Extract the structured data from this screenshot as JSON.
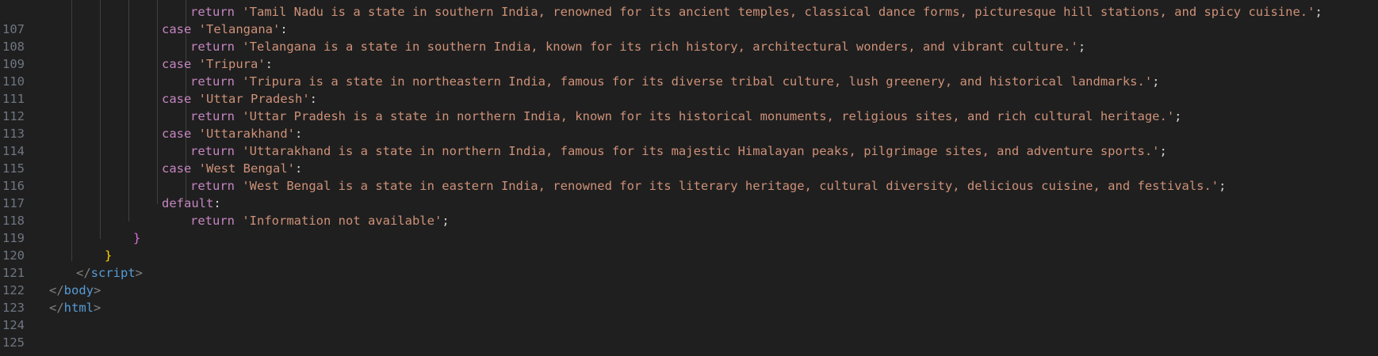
{
  "editor": {
    "theme_colors": {
      "background": "#1f1f1f",
      "line_number": "#6e7681",
      "keyword": "#c586c0",
      "string": "#ce9178",
      "punctuation": "#d4d4d4",
      "brace_level_2": "#da70d6",
      "brace_level_1": "#ffd700",
      "tag_bracket": "#808080",
      "tag_name": "#569cd6"
    },
    "lines": [
      {
        "num": "107",
        "kw": "return",
        "str": "'Tamil Nadu is a state in southern India, renowned for its ancient temples, classical dance forms, picturesque hill stations, and spicy cuisine.'",
        "end": ";"
      },
      {
        "num": "108",
        "kw": "case",
        "str": "'Telangana'",
        "end": ":"
      },
      {
        "num": "109",
        "kw": "return",
        "str": "'Telangana is a state in southern India, known for its rich history, architectural wonders, and vibrant culture.'",
        "end": ";"
      },
      {
        "num": "110",
        "kw": "case",
        "str": "'Tripura'",
        "end": ":"
      },
      {
        "num": "111",
        "kw": "return",
        "str": "'Tripura is a state in northeastern India, famous for its diverse tribal culture, lush greenery, and historical landmarks.'",
        "end": ";"
      },
      {
        "num": "112",
        "kw": "case",
        "str": "'Uttar Pradesh'",
        "end": ":"
      },
      {
        "num": "113",
        "kw": "return",
        "str": "'Uttar Pradesh is a state in northern India, known for its historical monuments, religious sites, and rich cultural heritage.'",
        "end": ";"
      },
      {
        "num": "114",
        "kw": "case",
        "str": "'Uttarakhand'",
        "end": ":"
      },
      {
        "num": "115",
        "kw": "return",
        "str": "'Uttarakhand is a state in northern India, famous for its majestic Himalayan peaks, pilgrimage sites, and adventure sports.'",
        "end": ";"
      },
      {
        "num": "116",
        "kw": "case",
        "str": "'West Bengal'",
        "end": ":"
      },
      {
        "num": "117",
        "kw": "return",
        "str": "'West Bengal is a state in eastern India, renowned for its literary heritage, cultural diversity, delicious cuisine, and festivals.'",
        "end": ";"
      },
      {
        "num": "118",
        "kw": "default",
        "str": "",
        "end": ":"
      },
      {
        "num": "119",
        "kw": "return",
        "str": "'Information not available'",
        "end": ";"
      },
      {
        "num": "120",
        "brace": "}"
      },
      {
        "num": "121",
        "brace": "}"
      },
      {
        "num": "122",
        "open": "</",
        "tag": "script",
        "close": ">"
      },
      {
        "num": "123",
        "open": "</",
        "tag": "body",
        "close": ">"
      },
      {
        "num": "124",
        "open": "</",
        "tag": "html",
        "close": ">"
      },
      {
        "num": "125"
      }
    ]
  }
}
